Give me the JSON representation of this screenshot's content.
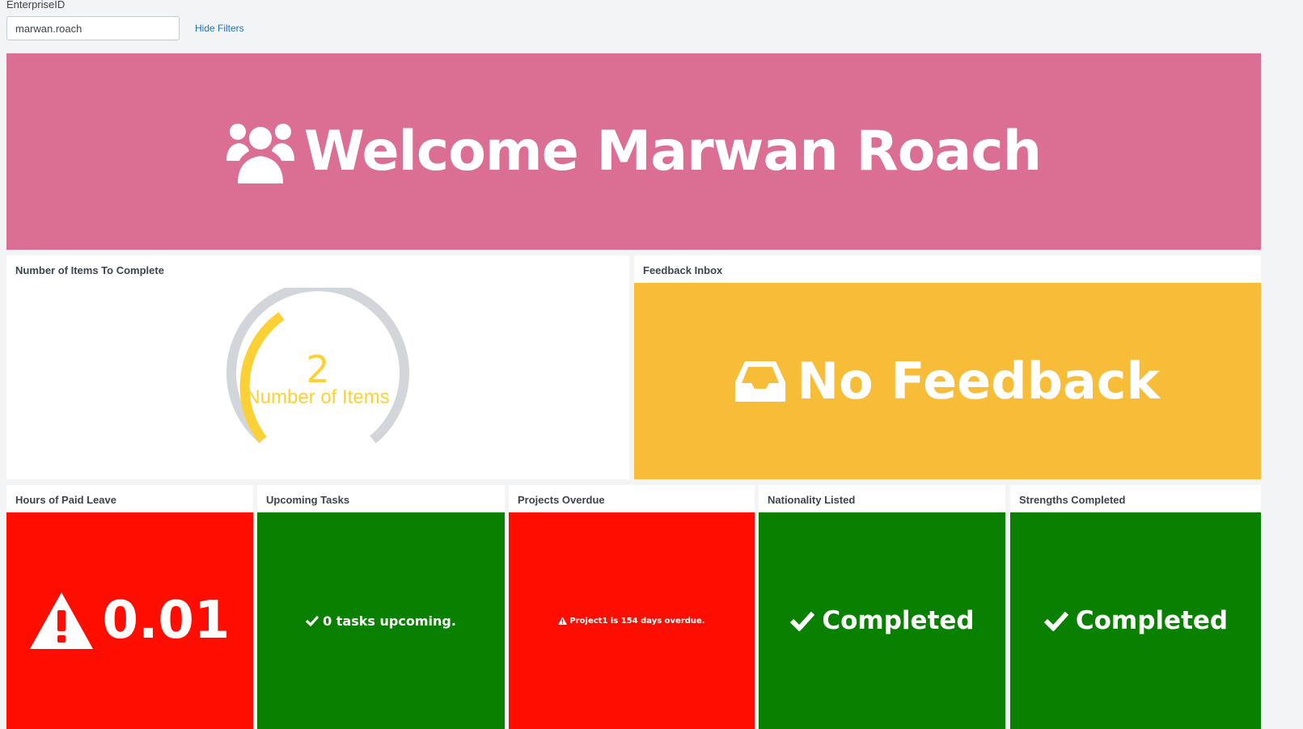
{
  "filters": {
    "label": "EnterpriseID",
    "value": "marwan.roach",
    "hide_label": "Hide Filters"
  },
  "banner": {
    "text": "Welcome Marwan Roach",
    "icon": "users-icon",
    "color": "#db6f93"
  },
  "items_panel": {
    "title": "Number of Items To Complete",
    "gauge": {
      "value": "2",
      "label": "Number of Items",
      "fraction": 0.3,
      "fill_color": "#fcd135",
      "track_color": "#d2d6da"
    }
  },
  "feedback_panel": {
    "title": "Feedback Inbox",
    "text": "No Feedback",
    "icon": "inbox-icon",
    "color": "#f7bd38"
  },
  "tiles": [
    {
      "title": "Hours of Paid Leave",
      "text": "0.01",
      "icon": "warning-icon",
      "color": "#ff0d00"
    },
    {
      "title": "Upcoming Tasks",
      "text": "0 tasks upcoming.",
      "icon": "check-icon",
      "color": "#0a8000"
    },
    {
      "title": "Projects Overdue",
      "text": "Project1 is 154 days overdue.",
      "icon": "warning-icon",
      "color": "#ff0d00"
    },
    {
      "title": "Nationality Listed",
      "text": "Completed",
      "icon": "check-icon",
      "color": "#0a8000"
    },
    {
      "title": "Strengths Completed",
      "text": "Completed",
      "icon": "check-icon",
      "color": "#0a8000"
    }
  ]
}
